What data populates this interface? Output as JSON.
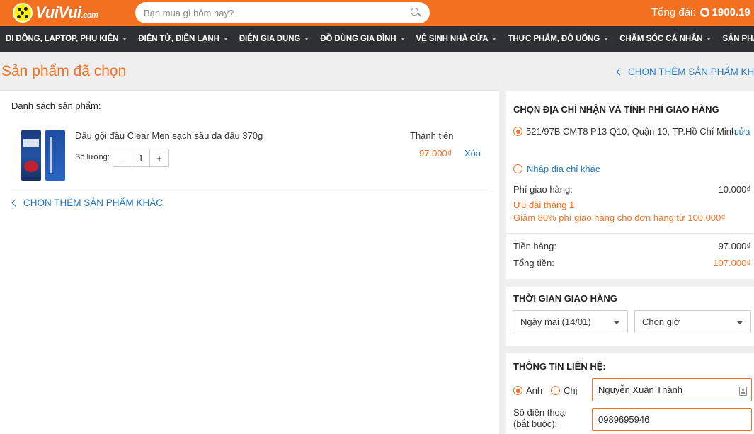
{
  "header": {
    "logo_text": "VuiVui",
    "logo_suffix": ".com",
    "search_placeholder": "Bạn mua gì hôm nay?",
    "hotline_label": "Tổng đài:",
    "hotline_number": "1900.19"
  },
  "nav": {
    "items": [
      "DI ĐỘNG, LAPTOP, PHỤ KIỆN",
      "ĐIỆN TỬ, ĐIỆN LẠNH",
      "ĐIỆN GIA DỤNG",
      "ĐỒ DÙNG GIA ĐÌNH",
      "VỆ SINH NHÀ CỬA",
      "THỰC PHẨM, ĐỒ UỐNG",
      "CHĂM SÓC CÁ NHÂN",
      "SẢN PHẨM CHO BÉ"
    ]
  },
  "page": {
    "title": "Sản phẩm đã chọn",
    "more_products_link": "CHỌN THÊM SẢN PHẨM KHÁC",
    "more_products_link_top": "CHỌN THÊM SẢN PHẨM KHÁC"
  },
  "cart": {
    "list_title": "Danh sách sản phẩm:",
    "total_label": "Thành tiền",
    "qty_label": "Số lượng:",
    "items": [
      {
        "name": "Dầu gội đầu Clear Men sạch sâu da đầu 370g",
        "quantity": "1",
        "minus": "-",
        "plus": "+",
        "price": "97.000₫",
        "remove_label": "Xóa"
      }
    ]
  },
  "shipping": {
    "title": "CHỌN ĐỊA CHỈ NHẬN VÀ TÍNH PHÍ GIAO HÀNG",
    "address": "521/97B CMT8 P13 Q10, Quận 10, TP.Hồ Chí Minh",
    "edit_label": "sửa",
    "other_address_label": "Nhập địa chỉ khác",
    "fee_label": "Phí giao hàng:",
    "fee_value": "10.000₫",
    "promo_title": "Ưu đãi tháng 1",
    "promo_detail": "Giảm 80% phí giao hàng cho đơn hàng từ 100.000₫",
    "subtotal_label": "Tiền hàng:",
    "subtotal_value": "97.000₫",
    "total_label": "Tổng tiền:",
    "total_value": "107.000₫"
  },
  "delivery_time": {
    "title": "THỜI GIAN GIAO HÀNG",
    "date_selected": "Ngày mai (14/01)",
    "time_selected": "Chọn giờ"
  },
  "contact": {
    "title": "THÔNG TIN LIÊN HỆ:",
    "gender_mr": "Anh",
    "gender_ms": "Chị",
    "name_value": "Nguyễn Xuân Thành",
    "phone_label": "Số điện thoại (bắt buộc):",
    "phone_value": "0989695946"
  },
  "colors": {
    "brand_orange": "#f37021",
    "nav_dark": "#2d3136",
    "link_blue": "#1e76c2"
  }
}
